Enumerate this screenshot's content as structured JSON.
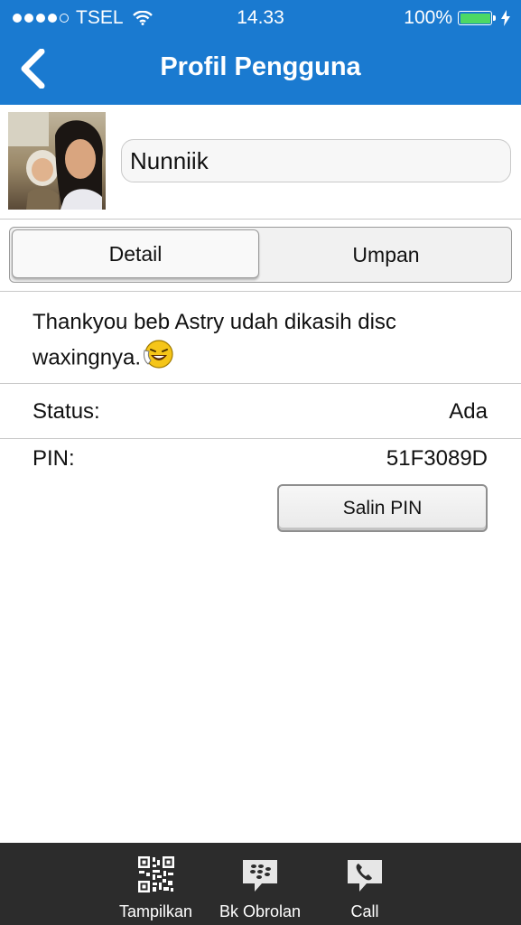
{
  "status_bar": {
    "carrier": "TSEL",
    "time": "14.33",
    "battery_percent": "100%",
    "signal_bars": 4,
    "signal_max": 5,
    "battery_level": 1.0
  },
  "header": {
    "title": "Profil Pengguna",
    "back_icon": "chevron-left-icon",
    "color": "#1a7ad0"
  },
  "profile": {
    "name": "Nunniik"
  },
  "tabs": [
    {
      "label": "Detail",
      "active": true
    },
    {
      "label": "Umpan",
      "active": false
    }
  ],
  "status_message": {
    "text": "Thankyou beb Astry udah dikasih disc waxingnya.",
    "emoji": "laughing-emoji"
  },
  "details": {
    "status_label": "Status:",
    "status_value": "Ada",
    "pin_label": "PIN:",
    "pin_value": "51F3089D",
    "copy_pin_label": "Salin PIN"
  },
  "toolbar": {
    "items": [
      {
        "label": "Tampilkan",
        "icon": "qr-code-icon"
      },
      {
        "label": "Bk Obrolan",
        "icon": "bbm-chat-icon"
      },
      {
        "label": "Call",
        "icon": "phone-icon"
      }
    ]
  }
}
